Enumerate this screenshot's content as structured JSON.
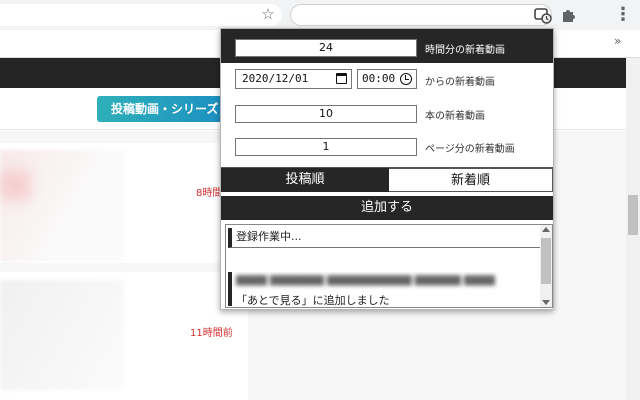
{
  "browser": {
    "star_icon": "star-icon",
    "extension_icon": "video-clock-icon",
    "puzzle_icon": "puzzle-icon",
    "menu_icon": "kebab-menu-icon",
    "bookmarks_more": "»"
  },
  "page": {
    "tab_button": "投稿動画・シリーズ",
    "time_label_1": "8時間",
    "time_label_2": "11時間前"
  },
  "popup": {
    "hours": {
      "value": "24",
      "label": "時間分の新着動画"
    },
    "since": {
      "date": "2020/12/01",
      "time": "00:00",
      "label": "からの新着動画"
    },
    "count": {
      "value": "10",
      "label": "本の新着動画"
    },
    "pages": {
      "value": "1",
      "label": "ページ分の新着動画"
    },
    "sort": {
      "option_post": "投稿順",
      "option_new": "新着順",
      "selected": "投稿順"
    },
    "add_button": "追加する",
    "log": {
      "entry_1": "登録作業中...",
      "entry_2_line_2": "「あとで見る」に追加しました"
    }
  },
  "colors": {
    "popup_dark": "#262626",
    "accent_red": "#d23030",
    "page_tab_gradient_start": "#2fb0b8",
    "page_tab_gradient_end": "#1d8fc2"
  }
}
